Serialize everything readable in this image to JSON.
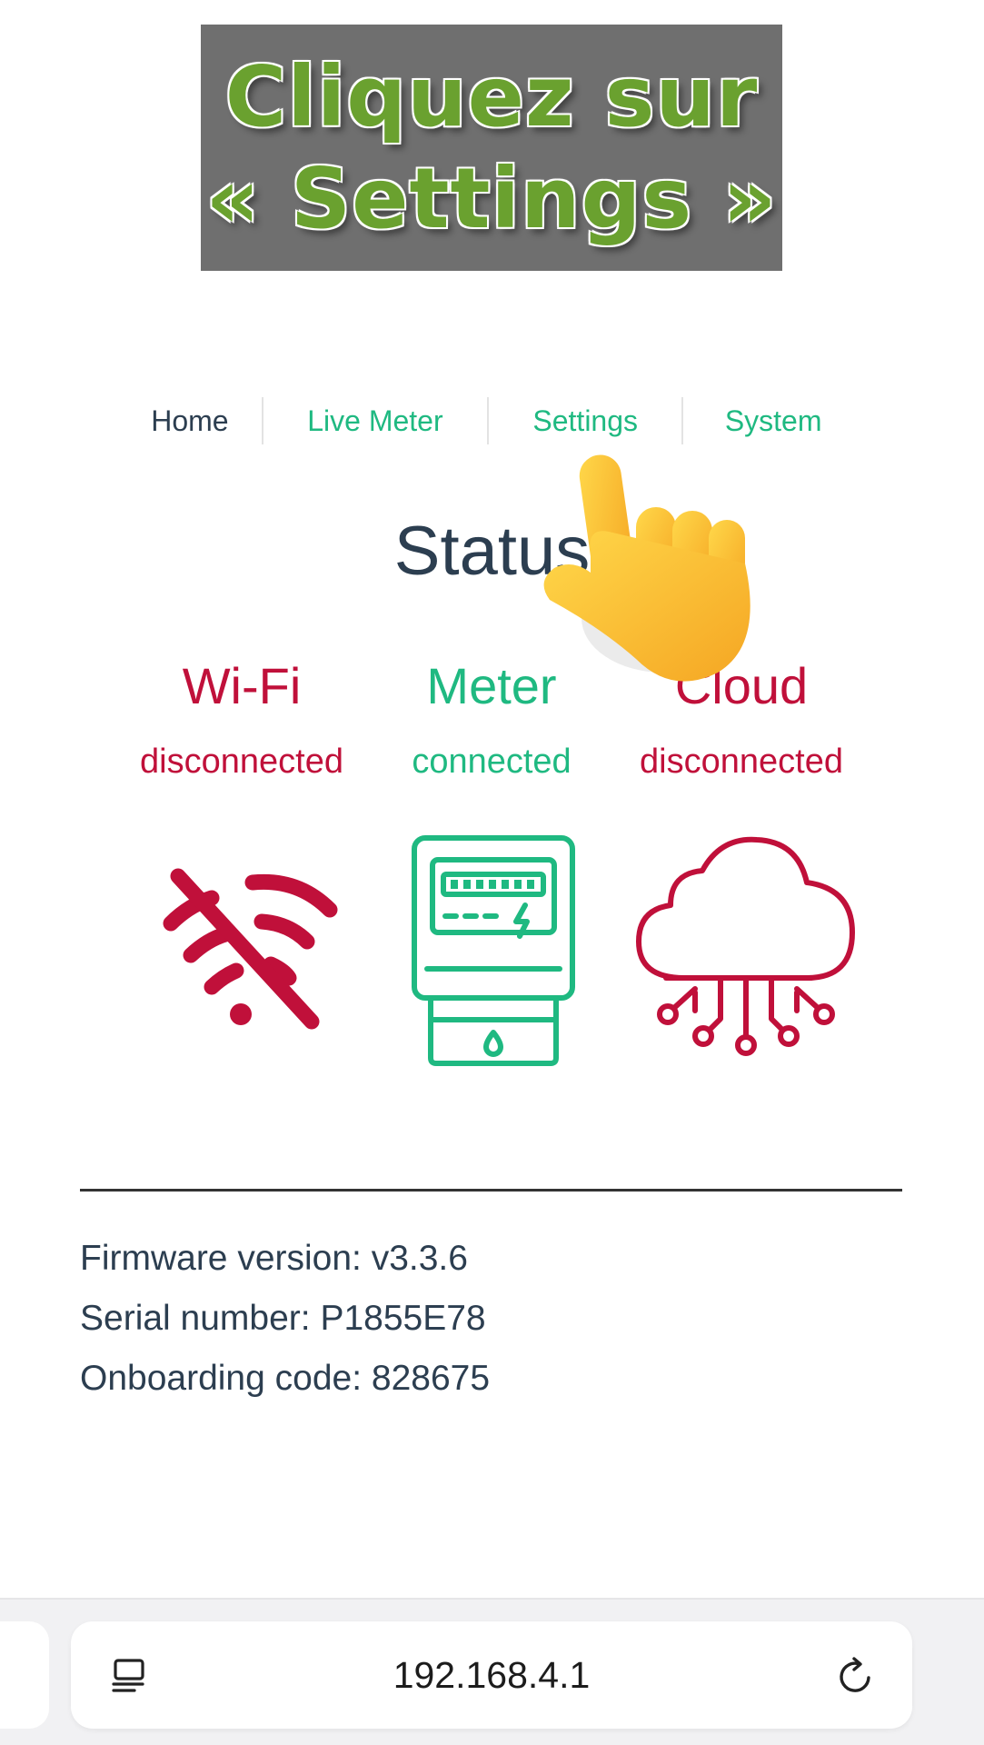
{
  "caption": {
    "line1": "Cliquez sur",
    "line2": "« Settings »"
  },
  "nav": {
    "home": "Home",
    "live_meter": "Live Meter",
    "settings": "Settings",
    "system": "System"
  },
  "status": {
    "title": "Status",
    "wifi": {
      "name": "Wi-Fi",
      "state": "disconnected",
      "icon": "wifi-off-icon"
    },
    "meter": {
      "name": "Meter",
      "state": "connected",
      "icon": "electric-meter-icon"
    },
    "cloud": {
      "name": "Cloud",
      "state": "disconnected",
      "icon": "cloud-network-icon"
    }
  },
  "info": {
    "firmware": "Firmware version: v3.3.6",
    "serial": "Serial number: P1855E78",
    "onboarding": "Onboarding code: 828675"
  },
  "browser": {
    "url": "192.168.4.1"
  },
  "colors": {
    "connected": "#1fb981",
    "disconnected": "#c0103a",
    "text": "#2c3e50",
    "caption_bg": "#6f6f6f",
    "caption_text": "#6aa12f"
  }
}
